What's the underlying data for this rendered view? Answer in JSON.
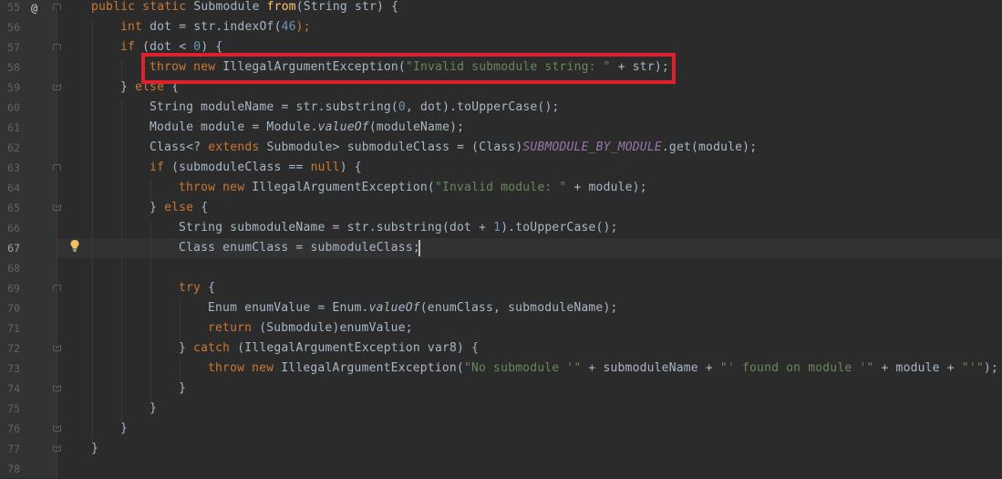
{
  "editor": {
    "current_line": "67",
    "lines": [
      {
        "num": "55"
      },
      {
        "num": "56"
      },
      {
        "num": "57"
      },
      {
        "num": "58"
      },
      {
        "num": "59"
      },
      {
        "num": "60"
      },
      {
        "num": "61"
      },
      {
        "num": "62"
      },
      {
        "num": "63"
      },
      {
        "num": "64"
      },
      {
        "num": "65"
      },
      {
        "num": "66"
      },
      {
        "num": "67"
      },
      {
        "num": "68"
      },
      {
        "num": "69"
      },
      {
        "num": "70"
      },
      {
        "num": "71"
      },
      {
        "num": "72"
      },
      {
        "num": "73"
      },
      {
        "num": "74"
      },
      {
        "num": "75"
      },
      {
        "num": "76"
      },
      {
        "num": "77"
      },
      {
        "num": "78"
      }
    ],
    "code": {
      "l55": {
        "a": "public static ",
        "b": "Submodule ",
        "c": "from",
        "d": "(String str) {"
      },
      "l56": {
        "a": "int ",
        "b": "dot = str.indexOf(",
        "c": "46",
        "d": ");"
      },
      "l57": {
        "a": "if ",
        "b": "(dot < ",
        "c": "0",
        "d": ") {"
      },
      "l58": {
        "a": "throw new ",
        "b": "IllegalArgumentException(",
        "c": "\"Invalid submodule string: \"",
        "d": " + str);"
      },
      "l59": {
        "a": "} ",
        "b": "else",
        "c": " {"
      },
      "l60": {
        "a": "String moduleName = str.substring(",
        "b": "0",
        "c": ", dot).toUpperCase();"
      },
      "l61": {
        "a": "Module module = Module.",
        "b": "valueOf",
        "c": "(moduleName);"
      },
      "l62": {
        "a": "Class<? ",
        "b": "extends ",
        "c": "Submodule> submoduleClass = (Class)",
        "d": "SUBMODULE_BY_MODULE",
        "e": ".get(module);"
      },
      "l63": {
        "a": "if ",
        "b": "(submoduleClass == ",
        "c": "null",
        "d": ") {"
      },
      "l64": {
        "a": "throw new ",
        "b": "IllegalArgumentException(",
        "c": "\"Invalid module: \"",
        "d": " + module);"
      },
      "l65": {
        "a": "} ",
        "b": "else",
        "c": " {"
      },
      "l66": {
        "a": "String submoduleName = str.substring(dot + ",
        "b": "1",
        "c": ").toUpperCase();"
      },
      "l67": {
        "a": "Class enumClass = submoduleClass;"
      },
      "l69": {
        "a": "try",
        "b": " {"
      },
      "l70": {
        "a": "Enum enumValue = Enum.",
        "b": "valueOf",
        "c": "(enumClass, submoduleName);"
      },
      "l71": {
        "a": "return ",
        "b": "(Submodule)enumValue;"
      },
      "l72": {
        "a": "} ",
        "b": "catch ",
        "c": "(IllegalArgumentException var8) {"
      },
      "l73": {
        "a": "throw new ",
        "b": "IllegalArgumentException(",
        "c": "\"No submodule '\"",
        "d": " + submoduleName + ",
        "e": "\"' found on module '\"",
        "f": " + module + ",
        "g": "\"'\"",
        "h": ");"
      },
      "l74": {
        "a": "}"
      },
      "l75": {
        "a": "}"
      },
      "l76": {
        "a": "}"
      },
      "l77": {
        "a": "}"
      }
    },
    "gutter_marks": {
      "override_marker": "@",
      "intention_icon": "lightbulb-icon"
    }
  },
  "colors": {
    "background": "#2b2b2b",
    "keyword": "#cc7832",
    "method_decl": "#ffc66d",
    "number": "#6897bb",
    "string": "#6a8759",
    "static_field": "#9876aa",
    "default_text": "#a9b7c6",
    "highlight_box": "#e0202a"
  }
}
